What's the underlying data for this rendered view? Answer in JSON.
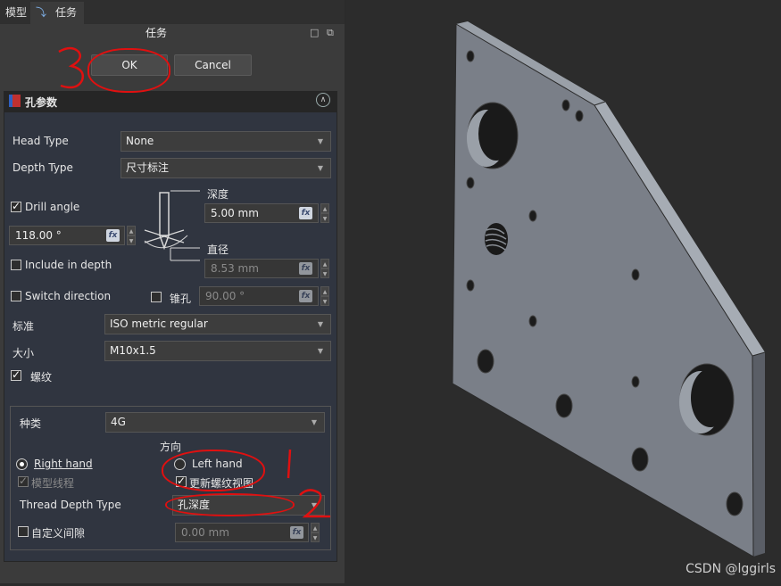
{
  "tabs": [
    {
      "label": "模型"
    },
    {
      "label": "任务"
    }
  ],
  "panel_title": "任务",
  "buttons": {
    "ok": "OK",
    "cancel": "Cancel"
  },
  "section_title": "孔参数",
  "head_type": {
    "label": "Head Type",
    "value": "None"
  },
  "depth_type": {
    "label": "Depth Type",
    "value": "尺寸标注"
  },
  "drill_angle": {
    "label": "Drill angle",
    "checked": true,
    "value": "118.00 °"
  },
  "depth": {
    "label": "深度",
    "value": "5.00 mm"
  },
  "diameter": {
    "label": "直径",
    "value": "8.53 mm"
  },
  "include_in_depth": {
    "label": "Include in depth",
    "checked": false
  },
  "switch_direction": {
    "label": "Switch direction",
    "checked": false
  },
  "countersink": {
    "label": "锥孔",
    "checked": false,
    "value": "90.00 °"
  },
  "standard": {
    "label": "标准",
    "value": "ISO metric regular"
  },
  "size": {
    "label": "大小",
    "value": "M10x1.5"
  },
  "thread": {
    "label": "螺纹",
    "checked": true
  },
  "thread_class": {
    "label": "种类",
    "value": "4G"
  },
  "direction_label": "方向",
  "right_hand": {
    "label": "Right hand",
    "selected": true
  },
  "left_hand": {
    "label": "Left hand",
    "selected": false
  },
  "model_thread": {
    "label": "模型线程",
    "checked": true
  },
  "update_view": {
    "label": "更新螺纹视图",
    "checked": true
  },
  "thread_depth_type": {
    "label": "Thread Depth Type",
    "value": "孔深度"
  },
  "custom_clearance": {
    "label": "自定义间隙",
    "checked": false,
    "value": "0.00 mm"
  },
  "annotations": [
    "3",
    "1",
    "2"
  ],
  "watermark": "CSDN @lggirls",
  "colors": {
    "annotation": "#e01010",
    "part": "#6e7480",
    "background": "#2c2c2c"
  }
}
